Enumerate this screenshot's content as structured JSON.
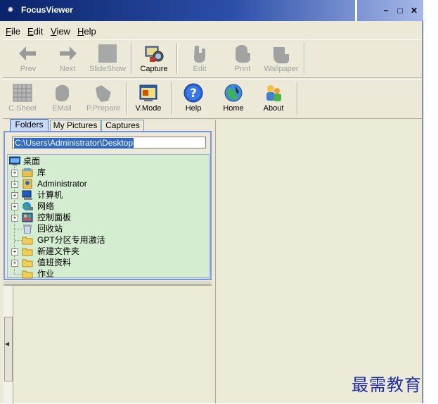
{
  "window": {
    "title": "FocusViewer",
    "controls": {
      "minimize": "−",
      "maximize": "□",
      "close": "✕"
    }
  },
  "menu": [
    {
      "label": "File",
      "accel": "F",
      "rest": "ile"
    },
    {
      "label": "Edit",
      "accel": "E",
      "rest": "dit"
    },
    {
      "label": "View",
      "accel": "V",
      "rest": "iew"
    },
    {
      "label": "Help",
      "accel": "H",
      "rest": "elp"
    }
  ],
  "toolbar1": {
    "prev": "Prev",
    "next": "Next",
    "slideshow": "SlideShow",
    "capture": "Capture",
    "edit": "Edit",
    "print": "Print",
    "wallpaper": "Wallpaper"
  },
  "toolbar2": {
    "csheet": "C.Sheet",
    "email": "EMail",
    "pprepare": "P.Prepare",
    "vmode": "V.Mode",
    "help": "Help",
    "home": "Home",
    "about": "About"
  },
  "tabs": [
    "Folders",
    "My Pictures",
    "Captures"
  ],
  "active_tab": "Folders",
  "path": "C:\\Users\\Administrator\\Desktop",
  "tree": {
    "root": "桌面",
    "items": [
      "库",
      "Administrator",
      "计算机",
      "网络",
      "控制面板",
      "回收站",
      "GPT分区专用激活",
      "新建文件夹",
      "值班资料",
      "作业"
    ]
  },
  "watermark": "最需教育",
  "colors": {
    "titlebar": "#0a246a",
    "tree_bg": "#d4ecd0",
    "selection": "#316ac5",
    "watermark": "#1d2aa8"
  }
}
